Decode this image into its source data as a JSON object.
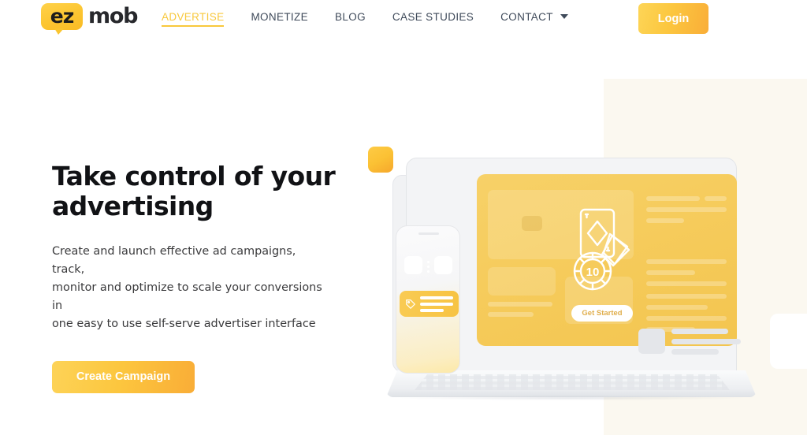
{
  "site": {
    "logo_primary": "ez",
    "logo_secondary": "mob"
  },
  "header": {
    "nav": [
      {
        "label": "ADVERTISE",
        "active": true,
        "has_dropdown": false
      },
      {
        "label": "MONETIZE",
        "active": false,
        "has_dropdown": false
      },
      {
        "label": "BLOG",
        "active": false,
        "has_dropdown": false
      },
      {
        "label": "CASE STUDIES",
        "active": false,
        "has_dropdown": false
      },
      {
        "label": "CONTACT",
        "active": false,
        "has_dropdown": true
      }
    ],
    "login_label": "Login"
  },
  "hero": {
    "title": "Take control of your\nadvertising",
    "subtitle": "Create and launch effective ad campaigns, track,\nmonitor and optimize to scale your conversions in\none easy to use self-serve advertiser interface",
    "cta_label": "Create Campaign"
  },
  "illustration": {
    "screen_button_label": "Get Started",
    "chip_value": "10"
  },
  "colors": {
    "brand_yellow": "#f8c83c",
    "button_gradient_start": "#fdd557",
    "button_gradient_end": "#f9ad38",
    "nav_text": "#3f4a5a",
    "headline": "#111215",
    "body_text": "#3a3a3c",
    "screen_yellow": "#f5cc5c",
    "panel_cream": "#fbf8f0",
    "device_grey": "#f1f2f4"
  }
}
